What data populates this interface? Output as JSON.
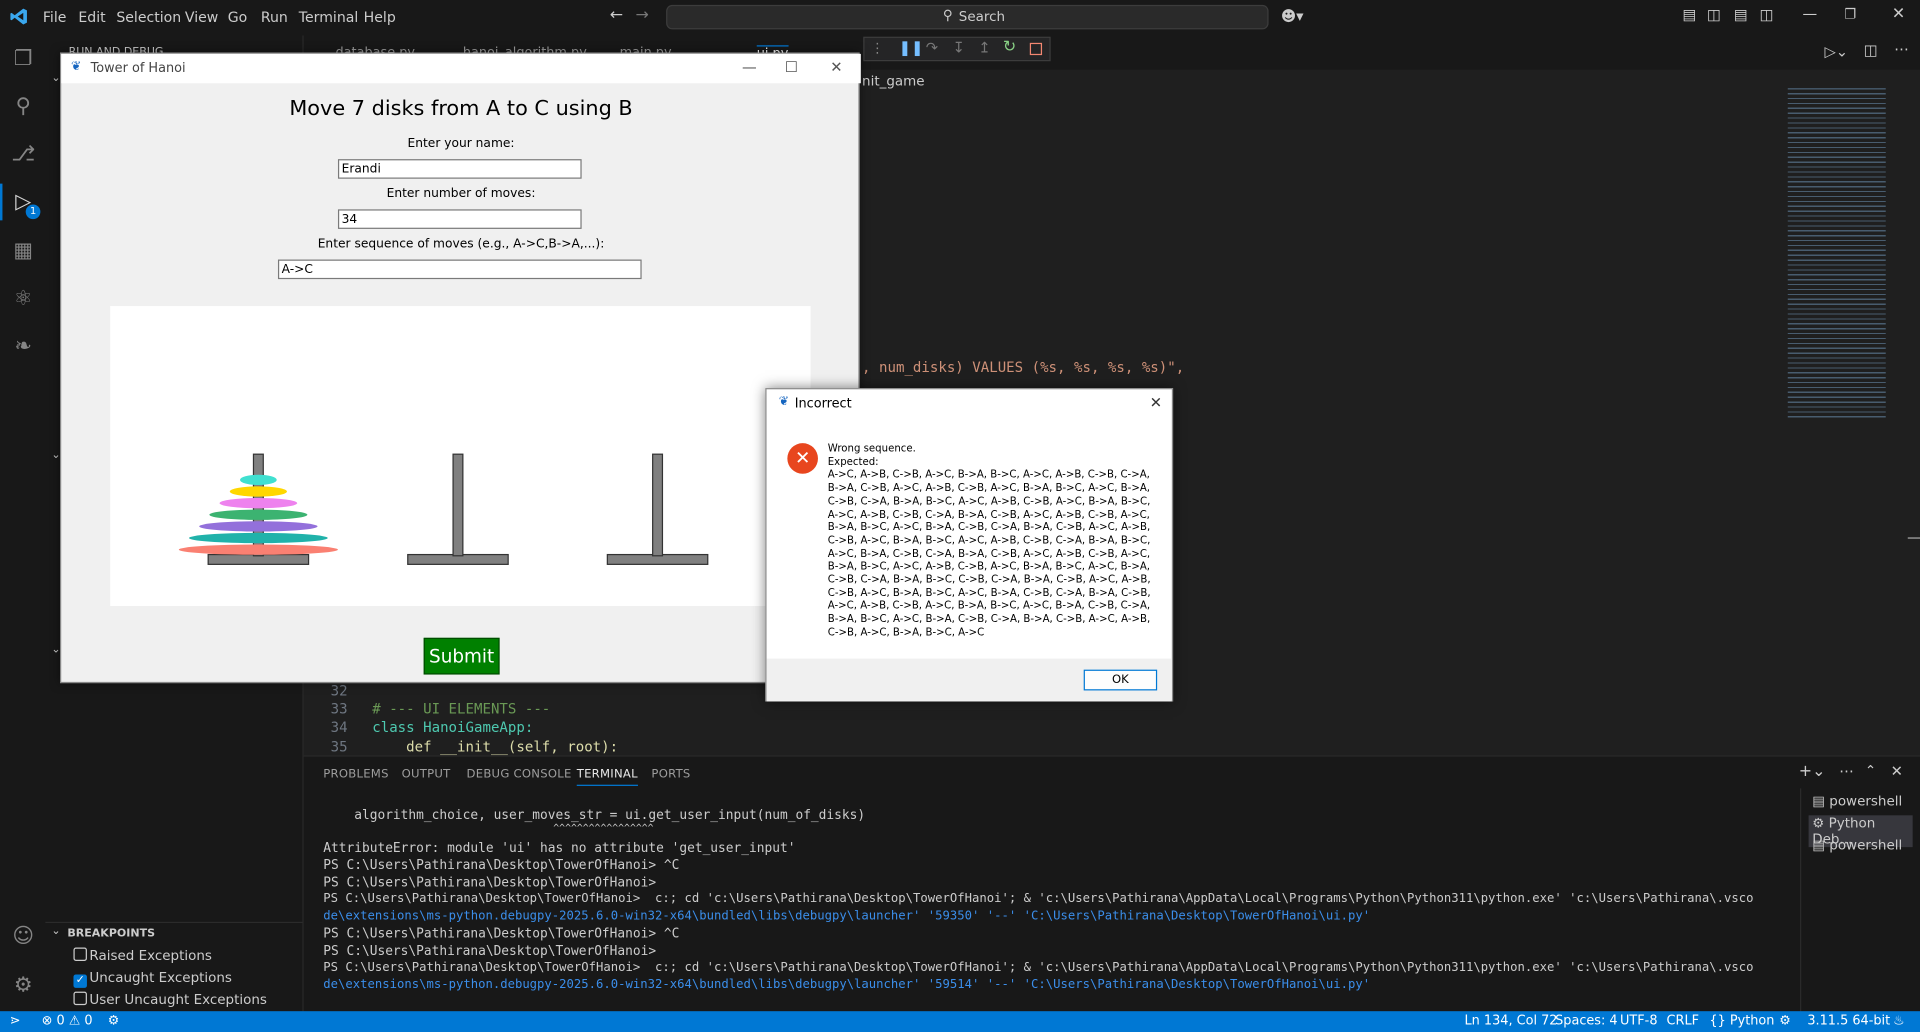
{
  "menu": [
    "File",
    "Edit",
    "Selection",
    "View",
    "Go",
    "Run",
    "Terminal",
    "Help"
  ],
  "search": {
    "label": "Search"
  },
  "sidebar": {
    "run_title": "RUN AND DEBUG",
    "breakpoints_title": "BREAKPOINTS",
    "breakpoints": [
      {
        "label": "Raised Exceptions",
        "checked": false
      },
      {
        "label": "Uncaught Exceptions",
        "checked": true
      },
      {
        "label": "User Uncaught Exceptions",
        "checked": false
      }
    ]
  },
  "editor_tabs": [
    "database.py",
    "hanoi_algorithm.py",
    "main.py",
    "ui.py"
  ],
  "editor": {
    "breadcrumb_fragment": "nit_game",
    "sql_fragment": ", num_disks) VALUES (%s, %s, %s, %s)\",",
    "lines": [
      {
        "num": "32",
        "text": ""
      },
      {
        "num": "33",
        "text": "# --- UI ELEMENTS ---"
      },
      {
        "num": "34",
        "text": "class HanoiGameApp:"
      },
      {
        "num": "35",
        "text": "    def __init__(self, root):"
      }
    ]
  },
  "panel": {
    "tabs": [
      "PROBLEMS",
      "OUTPUT",
      "DEBUG CONSOLE",
      "TERMINAL",
      "PORTS"
    ],
    "active_tab": "TERMINAL",
    "terminal_lines": [
      "    algorithm_choice, user_moves_str = ui.get_user_input(num_of_disks)",
      "                                       ^^^^^^^^^^^^^^^^^",
      "AttributeError: module 'ui' has no attribute 'get_user_input'",
      "PS C:\\Users\\Pathirana\\Desktop\\TowerOfHanoi> ^C",
      "PS C:\\Users\\Pathirana\\Desktop\\TowerOfHanoi>",
      "PS C:\\Users\\Pathirana\\Desktop\\TowerOfHanoi>  c:; cd 'c:\\Users\\Pathirana\\Desktop\\TowerOfHanoi'; & 'c:\\Users\\Pathirana\\AppData\\Local\\Programs\\Python\\Python311\\python.exe' 'c:\\Users\\Pathirana\\.vsco",
      "de\\extensions\\ms-python.debugpy-2025.6.0-win32-x64\\bundled\\libs\\debugpy\\launcher' '59350' '--' 'C:\\Users\\Pathirana\\Desktop\\TowerOfHanoi\\ui.py'",
      "PS C:\\Users\\Pathirana\\Desktop\\TowerOfHanoi> ^C",
      "PS C:\\Users\\Pathirana\\Desktop\\TowerOfHanoi>",
      "PS C:\\Users\\Pathirana\\Desktop\\TowerOfHanoi>  c:; cd 'c:\\Users\\Pathirana\\Desktop\\TowerOfHanoi'; & 'c:\\Users\\Pathirana\\AppData\\Local\\Programs\\Python\\Python311\\python.exe' 'c:\\Users\\Pathirana\\.vsco",
      "de\\extensions\\ms-python.debugpy-2025.6.0-win32-x64\\bundled\\libs\\debugpy\\launcher' '59514' '--' 'C:\\Users\\Pathirana\\Desktop\\TowerOfHanoi\\ui.py'"
    ],
    "terminal_list": [
      "powershell",
      "Python Deb...",
      "powershell"
    ]
  },
  "status": {
    "errors": "0",
    "warnings": "0",
    "position": "Ln 134, Col 72",
    "spaces": "Spaces: 4",
    "encoding": "UTF-8",
    "eol": "CRLF",
    "language": "Python",
    "interpreter": "3.11.5 64-bit"
  },
  "hanoi": {
    "window_title": "Tower of Hanoi",
    "heading": "Move 7 disks from A to C using B",
    "name_label": "Enter your name:",
    "name_value": "Erandi",
    "moves_label": "Enter number of moves:",
    "moves_value": "34",
    "seq_label": "Enter sequence of moves (e.g., A->C,B->A,...):",
    "seq_value": "A->C",
    "submit": "Submit",
    "disks": [
      {
        "color": "#40e0d0"
      },
      {
        "color": "#ffd700"
      },
      {
        "color": "#ee82ee"
      },
      {
        "color": "#3cb371"
      },
      {
        "color": "#9370db"
      },
      {
        "color": "#20b2aa"
      },
      {
        "color": "#fa8072"
      }
    ]
  },
  "dialog": {
    "title": "Incorrect",
    "message": "Wrong sequence.\nExpected:\nA->C, A->B, C->B, A->C, B->A, B->C, A->C, A->B, C->B, C->A, B->A, C->B, A->C, A->B, C->B, A->C, B->A, B->C, A->C, B->A, C->B, C->A, B->A, B->C, A->C, A->B, C->B, A->C, B->A, B->C, A->C, A->B, C->B, C->A, B->A, C->B, A->C, A->B, C->B, A->C, B->A, B->C, A->C, B->A, C->B, C->A, B->A, C->B, A->C, A->B, C->B, A->C, B->A, B->C, A->C, A->B, C->B, C->A, B->A, B->C, A->C, B->A, C->B, C->A, B->A, C->B, A->C, A->B, C->B, A->C, B->A, B->C, A->C, A->B, C->B, A->C, B->A, B->C, A->C, B->A, C->B, C->A, B->A, B->C, C->B, C->A, B->A, C->B, A->C, A->B, C->B, A->C, B->A, B->C, A->C, B->A, C->B, C->A, B->A, C->B, A->C, A->B, C->B, A->C, B->A, B->C, A->C, B->A, C->B, C->A, B->A, B->C, A->C, B->A, C->B, C->A, B->A, C->B, A->C, A->B, C->B, A->C, B->A, B->C, A->C",
    "ok": "OK"
  }
}
